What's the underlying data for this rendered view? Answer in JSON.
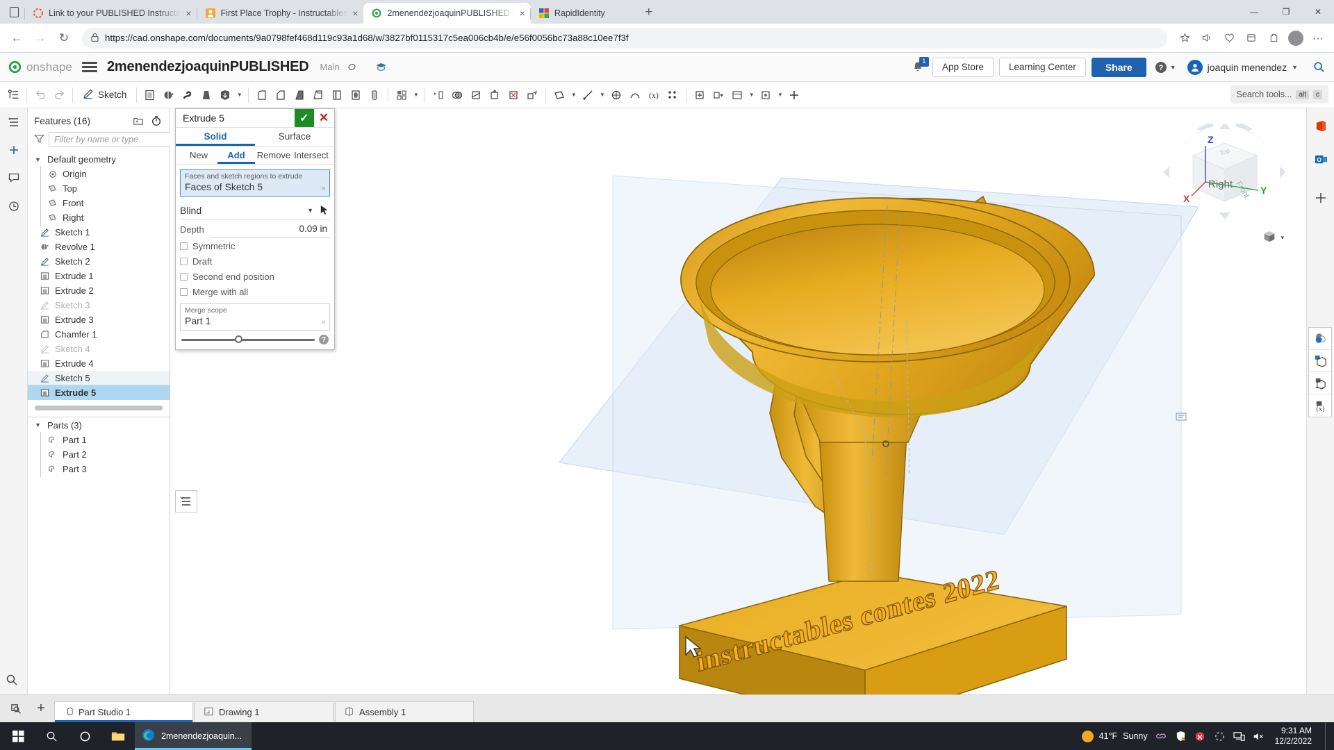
{
  "browser": {
    "tabs": [
      {
        "label": "Link to your PUBLISHED Instructa",
        "favicon": "instructables-icon",
        "close": "×",
        "active": false
      },
      {
        "label": "First Place Trophy - Instructables",
        "favicon": "trophy-icon",
        "close": "×",
        "active": false
      },
      {
        "label": "2menendezjoaquinPUBLISHED | ",
        "favicon": "onshape-icon",
        "close": "×",
        "active": true
      },
      {
        "label": "RapidIdentity",
        "favicon": "rapididentity-icon",
        "close": "",
        "active": false
      }
    ],
    "new_tab_label": "+",
    "window_controls": {
      "minimize": "—",
      "maximize": "❐",
      "close": "✕"
    },
    "nav": {
      "back": "←",
      "forward": "→",
      "reload": "↻"
    },
    "url": "https://cad.onshape.com/documents/9a0798fef468d119c93a1d68/w/3827bf0115317c5ea006cb4b/e/e56f0056bc73a88c10ee7f3f",
    "lock_icon": "lock-icon",
    "toolbar_icons": [
      "bookmark-star-icon",
      "read-aloud-icon",
      "favorites-icon",
      "collections-icon",
      "browser-extensions-icon",
      "profile-icon",
      "settings-ellipsis-icon"
    ]
  },
  "onshape_header": {
    "logo_word": "onshape",
    "document_title": "2menendezjoaquinPUBLISHED",
    "branch": "Main",
    "link_icon": "link-icon",
    "learning_icon": "graduation-cap-icon",
    "notification_count": "1",
    "app_store": "App Store",
    "learning_center": "Learning Center",
    "share": "Share",
    "help_icon": "question-circle-icon",
    "user_name": "joaquin menendez",
    "search_magnifier": "search-icon"
  },
  "toolbar": {
    "sketch_label": "Sketch",
    "search_tools_placeholder": "Search tools...",
    "shortcut_alt": "alt",
    "shortcut_key": "c"
  },
  "feature_panel": {
    "title": "Features (16)",
    "folder_icon": "new-folder-icon",
    "rollback_icon": "history-timer-icon",
    "filter_icon": "funnel-filter-icon",
    "filter_placeholder": "Filter by name or type",
    "tree": [
      {
        "label": "Default geometry",
        "icon": "chevron-down-icon",
        "type": "group"
      },
      {
        "label": "Origin",
        "icon": "origin-icon",
        "type": "child"
      },
      {
        "label": "Top",
        "icon": "plane-icon",
        "type": "child"
      },
      {
        "label": "Front",
        "icon": "plane-icon",
        "type": "child"
      },
      {
        "label": "Right",
        "icon": "plane-icon",
        "type": "child"
      },
      {
        "label": "Sketch 1",
        "icon": "sketch-icon",
        "type": "item"
      },
      {
        "label": "Revolve 1",
        "icon": "revolve-icon",
        "type": "item"
      },
      {
        "label": "Sketch 2",
        "icon": "sketch-icon",
        "type": "item"
      },
      {
        "label": "Extrude 1",
        "icon": "extrude-icon",
        "type": "item"
      },
      {
        "label": "Extrude 2",
        "icon": "extrude-icon",
        "type": "item"
      },
      {
        "label": "Sketch 3",
        "icon": "sketch-icon",
        "type": "suppressed"
      },
      {
        "label": "Extrude 3",
        "icon": "extrude-icon",
        "type": "item"
      },
      {
        "label": "Chamfer 1",
        "icon": "chamfer-icon",
        "type": "item"
      },
      {
        "label": "Sketch 4",
        "icon": "sketch-icon",
        "type": "suppressed"
      },
      {
        "label": "Extrude 4",
        "icon": "extrude-icon",
        "type": "item"
      },
      {
        "label": "Sketch 5",
        "icon": "sketch-icon",
        "type": "selected-light"
      },
      {
        "label": "Extrude 5",
        "icon": "extrude-icon",
        "type": "selected"
      }
    ],
    "parts_title": "Parts (3)",
    "parts": [
      {
        "label": "Part 1",
        "icon": "part-icon"
      },
      {
        "label": "Part 2",
        "icon": "part-icon"
      },
      {
        "label": "Part 3",
        "icon": "part-icon"
      }
    ]
  },
  "extrude_dialog": {
    "title": "Extrude 5",
    "accept": "✓",
    "cancel": "✕",
    "type_tabs": [
      {
        "label": "Solid",
        "active": true
      },
      {
        "label": "Surface",
        "active": false
      }
    ],
    "op_tabs": [
      {
        "label": "New",
        "active": false
      },
      {
        "label": "Add",
        "active": true
      },
      {
        "label": "Remove",
        "active": false
      },
      {
        "label": "Intersect",
        "active": false
      }
    ],
    "query_label": "Faces and sketch regions to extrude",
    "query_value": "Faces of Sketch 5",
    "query_clear": "×",
    "end_condition": "Blind",
    "pick_icon": "pick-arrow-icon",
    "depth_label": "Depth",
    "depth_value": "0.09 in",
    "checkboxes": [
      {
        "label": "Symmetric",
        "checked": false
      },
      {
        "label": "Draft",
        "checked": false
      },
      {
        "label": "Second end position",
        "checked": false
      },
      {
        "label": "Merge with all",
        "checked": false
      }
    ],
    "merge_scope_label": "Merge scope",
    "merge_scope_value": "Part 1",
    "merge_scope_clear": "×",
    "help_icon": "question-mark-icon"
  },
  "viewport": {
    "view_cube_face": "Right",
    "axis_x": "X",
    "axis_y": "Y",
    "axis_z": "Z",
    "model_text": "instructables contes 2022",
    "model_color": "#E8A317",
    "plane_color": "#cfe0f0",
    "display_style_icon": "shaded-cube-icon",
    "display_style_caret": "▾",
    "right_tools": [
      "office-icon",
      "outlook-icon",
      "add-panel-icon",
      "appearance-icon",
      "measure-cube-icon",
      "mass-properties-icon",
      "variable-table-icon"
    ]
  },
  "document_tabs": {
    "search_icon": "tab-search-icon",
    "add_label": "+",
    "tabs": [
      {
        "label": "Part Studio 1",
        "icon": "part-studio-icon",
        "active": true
      },
      {
        "label": "Drawing 1",
        "icon": "drawing-icon",
        "active": false
      },
      {
        "label": "Assembly 1",
        "icon": "assembly-icon",
        "active": false
      }
    ]
  },
  "taskbar": {
    "start_icon": "windows-start-icon",
    "search_icon": "taskbar-search-icon",
    "cortana_icon": "cortana-circle-icon",
    "explorer_icon": "file-explorer-icon",
    "app_label": "2menendezjoaquin...",
    "app_icon": "edge-icon",
    "temperature": "41°F",
    "weather": "Sunny",
    "tray_icons": [
      "link-tray-icon",
      "security-warning-icon",
      "antivirus-alert-icon",
      "loading-spinner-icon",
      "network-icon",
      "volume-muted-icon"
    ],
    "time": "9:31 AM",
    "date": "12/2/2022"
  }
}
